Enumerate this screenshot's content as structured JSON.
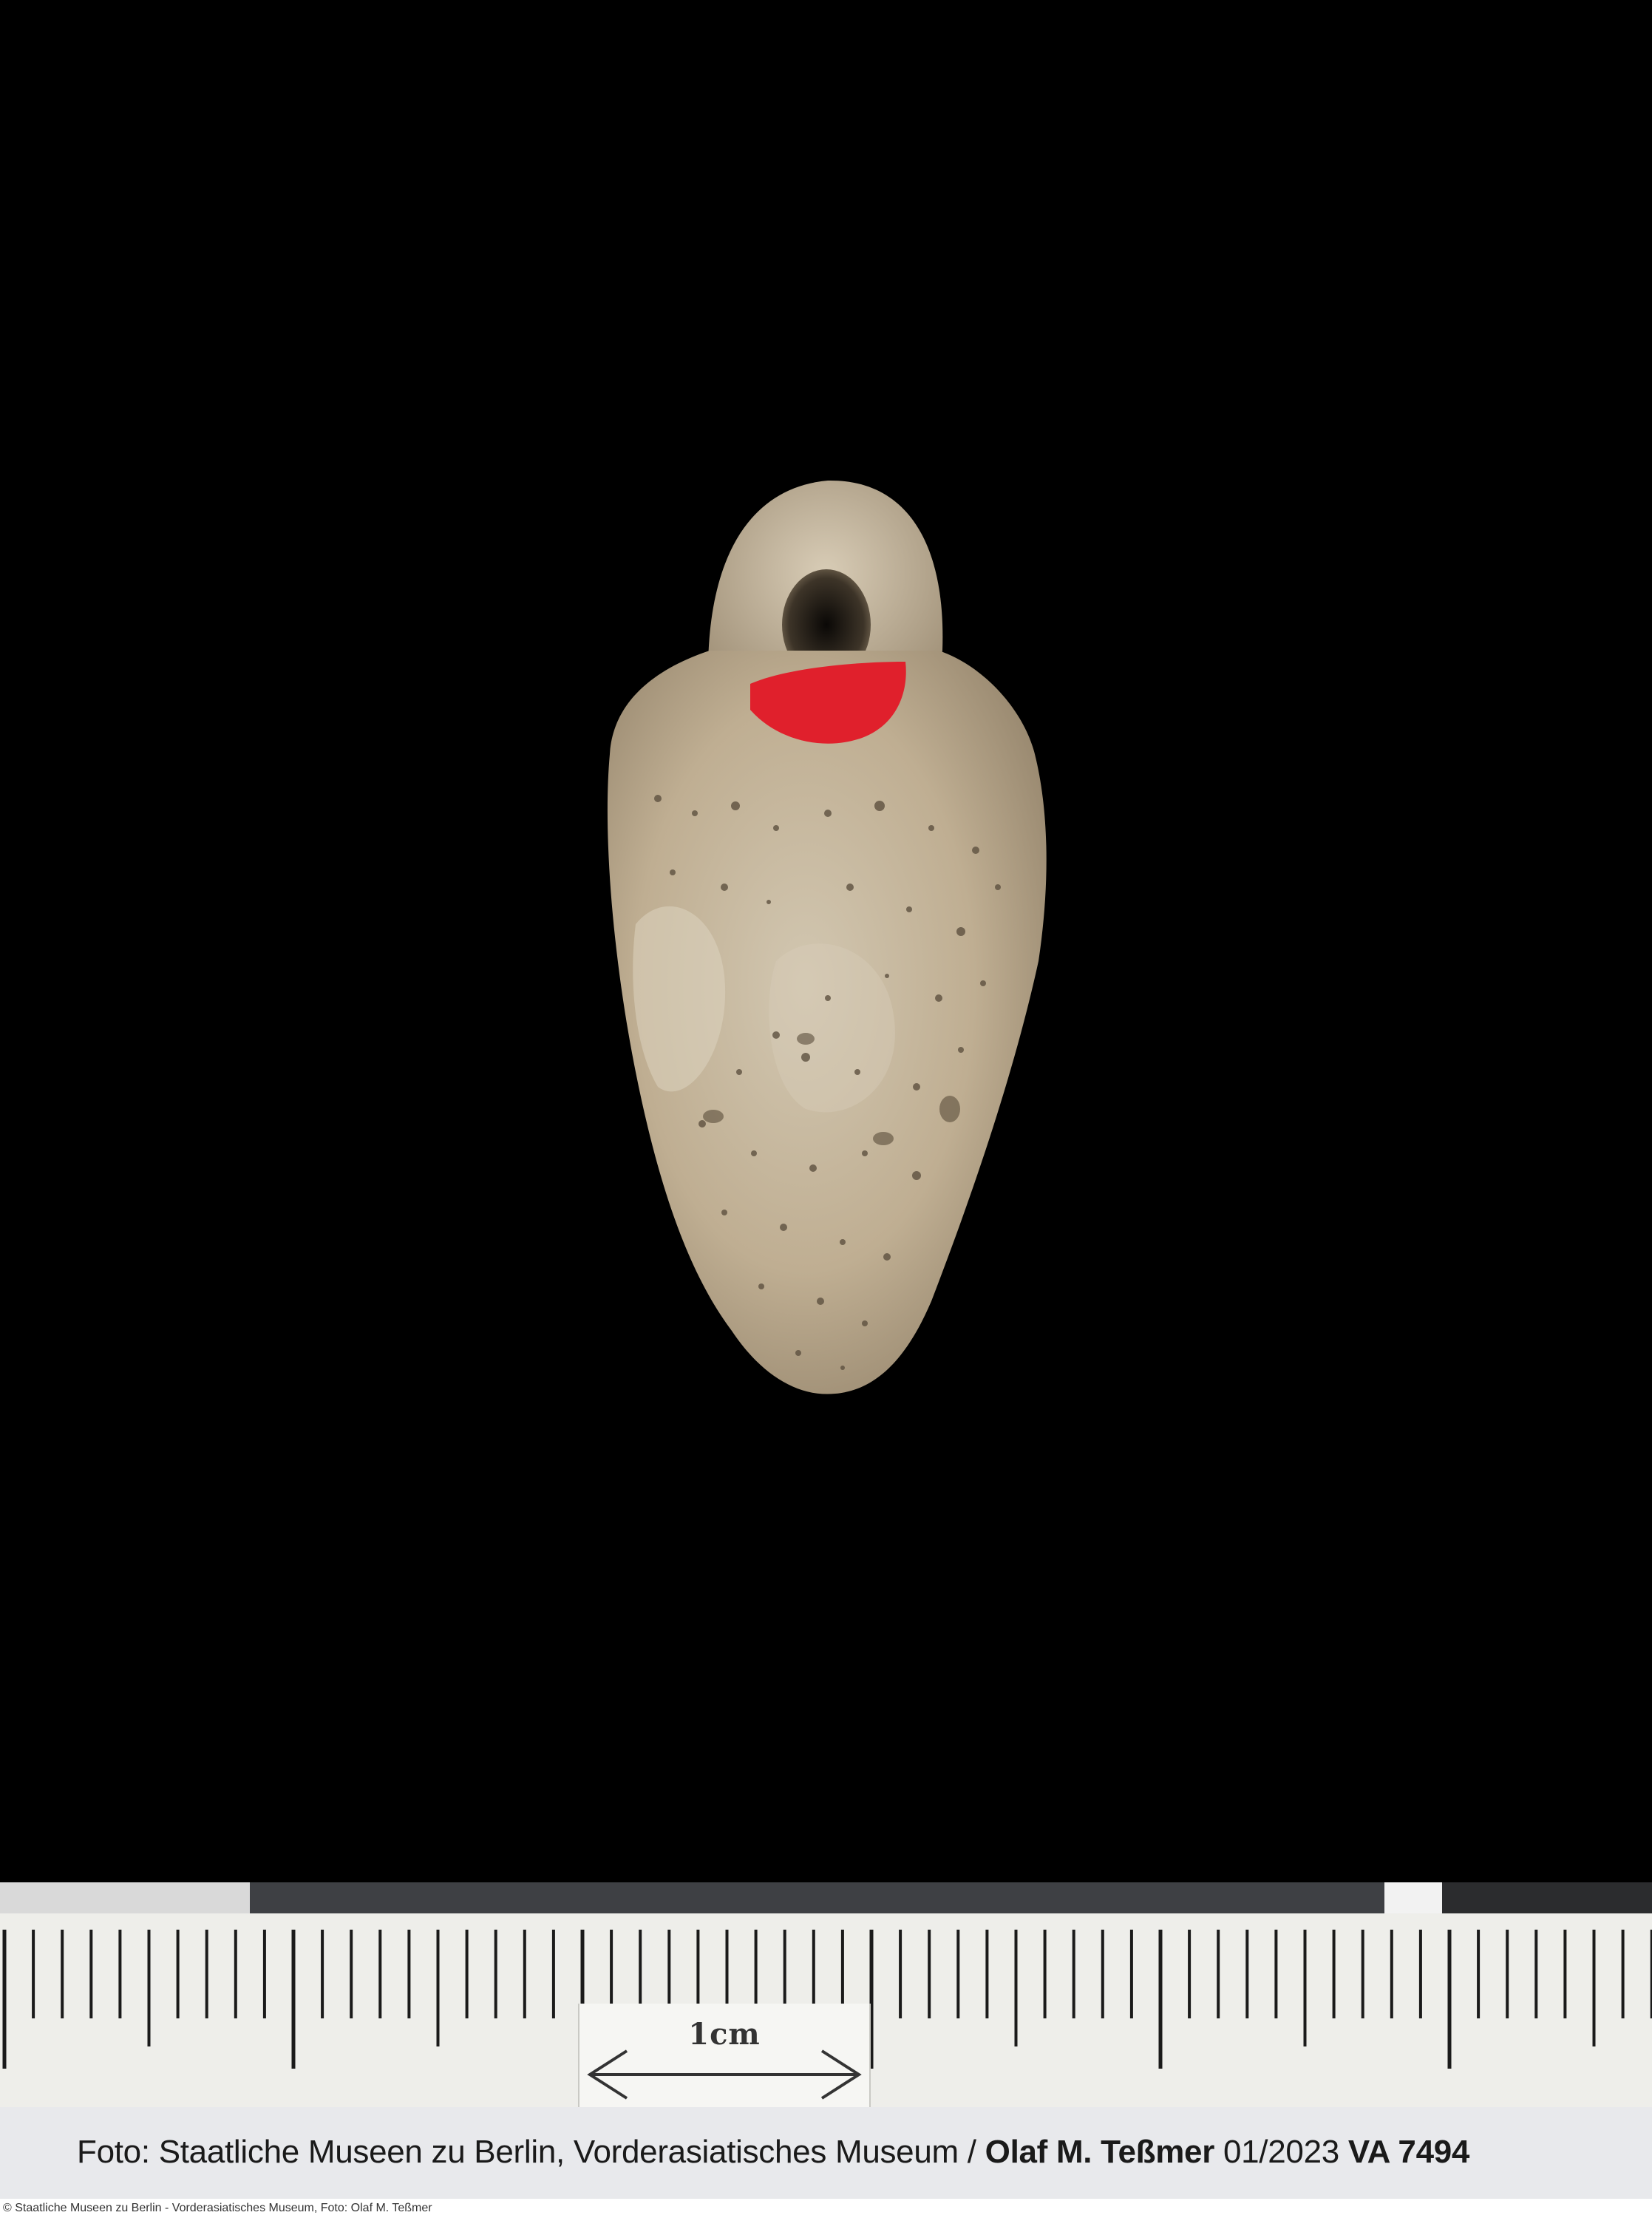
{
  "artifact": {
    "icon": "stone-pendant-amulet",
    "colors": {
      "background": "#000000",
      "stone": "#c2b49a",
      "label_dot": "#e0202c"
    }
  },
  "scale": {
    "label": "1cm"
  },
  "caption": {
    "prefix": "Foto: Staatliche Museen zu Berlin, Vorderasiatisches Museum / ",
    "photographer": "Olaf M. Teßmer",
    "date": " 01/2023 ",
    "inventory": "VA 7494"
  },
  "footer": {
    "credit": "© Staatliche Museen zu Berlin - Vorderasiatisches Museum, Foto: Olaf M. Teßmer"
  }
}
